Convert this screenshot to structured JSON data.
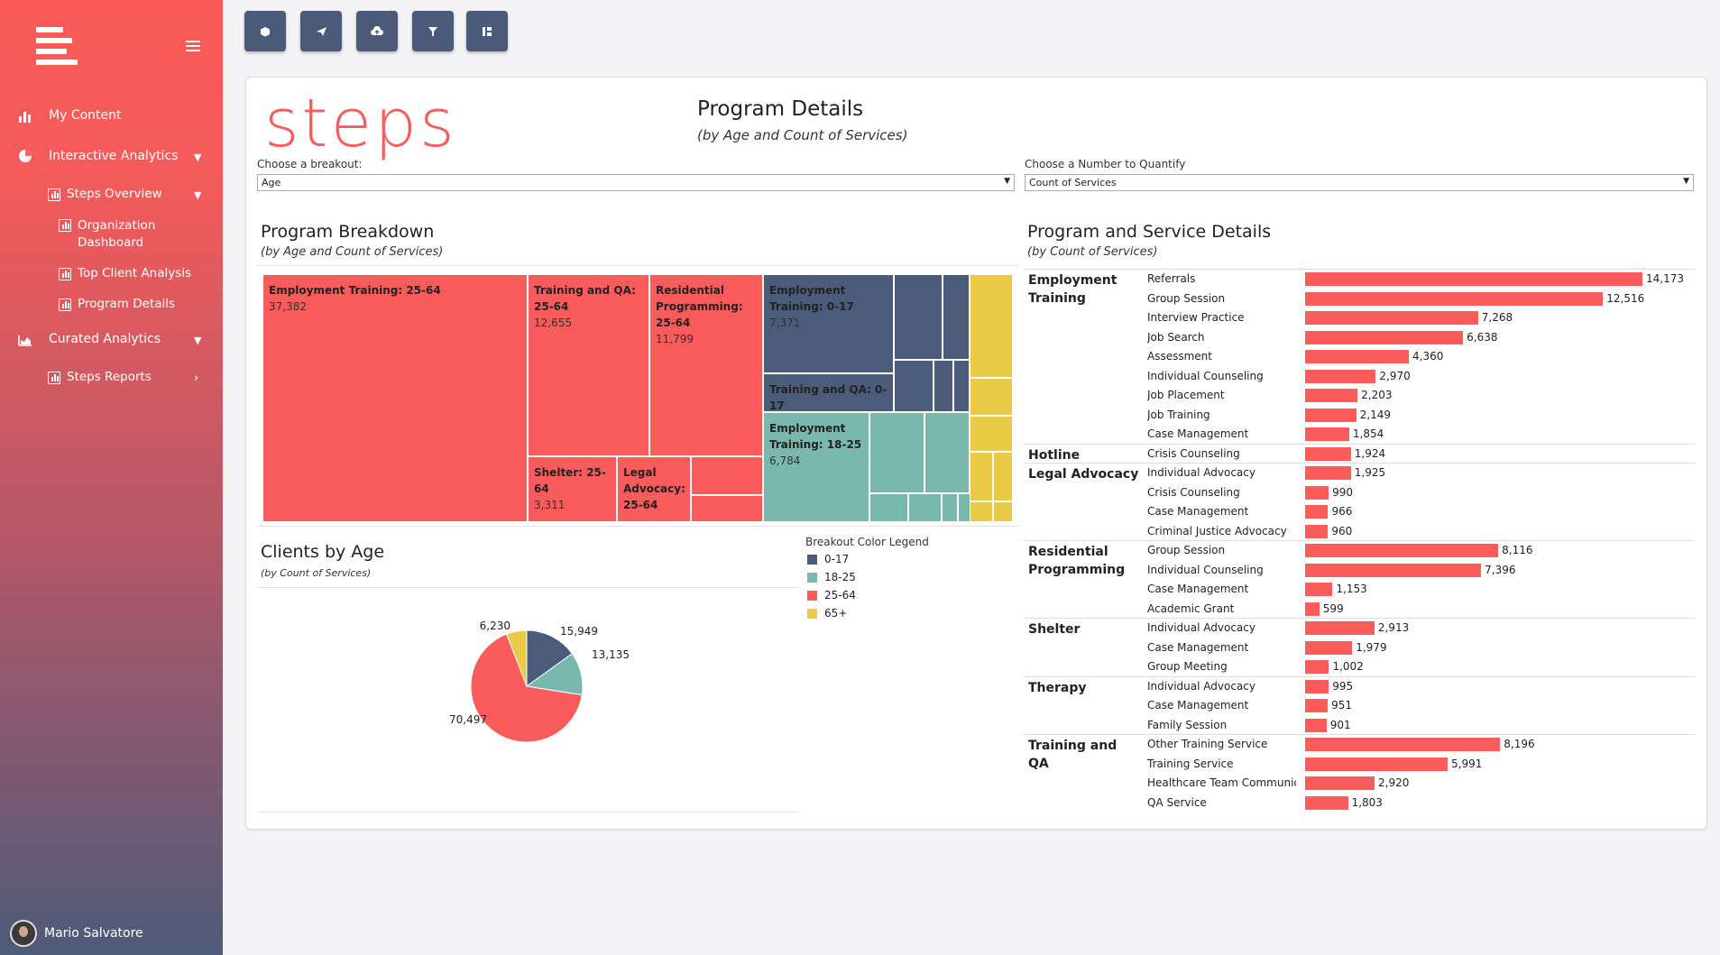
{
  "sidebar": {
    "nav": [
      {
        "label": "My Content",
        "icon": "bar-chart-icon"
      },
      {
        "label": "Interactive Analytics",
        "icon": "pie-chart-icon"
      },
      {
        "label": "Curated Analytics",
        "icon": "area-chart-icon"
      }
    ],
    "sub_items": [
      {
        "label": "Steps Overview"
      },
      {
        "label": "Organization Dashboard"
      },
      {
        "label": "Top Client Analysis"
      },
      {
        "label": "Program Details"
      },
      {
        "label": "Steps Reports"
      }
    ],
    "user": "Mario Salvatore"
  },
  "toolbar": [
    "cube-icon",
    "send-icon",
    "cloud-upload-icon",
    "filter-icon",
    "columns-icon"
  ],
  "header": {
    "brand": "steps",
    "title": "Program Details",
    "subtitle": "(by Age and Count of Services)"
  },
  "filters": {
    "breakout_label": "Choose a breakout:",
    "breakout_value": "Age",
    "quantify_label": "Choose a Number to Quantify",
    "quantify_value": "Count of Services"
  },
  "breakdown": {
    "title": "Program Breakdown",
    "subtitle": "(by Age and Count of Services)",
    "tiles": [
      {
        "label": "Employment Training: 25-64",
        "value": "37,382"
      },
      {
        "label": "Training and QA: 25-64",
        "value": "12,655"
      },
      {
        "label": "Residential Programming: 25-64",
        "value": "11,799"
      },
      {
        "label": "Shelter: 25-64",
        "value": "3,311"
      },
      {
        "label": "Legal Advocacy: 25-64",
        "value": ""
      },
      {
        "label": "Employment Training: 0-17",
        "value": "7,371"
      },
      {
        "label": "Training and QA: 0-17",
        "value": ""
      },
      {
        "label": "Employment Training: 18-25",
        "value": "6,784"
      }
    ]
  },
  "clients": {
    "title": "Clients by Age",
    "subtitle": "(by Count of Services)"
  },
  "legend": {
    "title": "Breakout Color Legend",
    "items": [
      {
        "label": "0-17",
        "color": "#4a5c7a"
      },
      {
        "label": "18-25",
        "color": "#79b8ad"
      },
      {
        "label": "25-64",
        "color": "#fa5b5b"
      },
      {
        "label": "65+",
        "color": "#eaca47"
      }
    ]
  },
  "details": {
    "title": "Program and Service Details",
    "subtitle": "(by Count of Services)"
  },
  "chart_data": [
    {
      "type": "pie",
      "labels": [
        "0-17",
        "18-25",
        "25-64",
        "65+"
      ],
      "values": [
        15949,
        13135,
        70497,
        6230
      ],
      "value_labels": [
        "15,949",
        "13,135",
        "70,497",
        "6,230"
      ],
      "colors": [
        "#4a5c7a",
        "#79b8ad",
        "#fa5b5b",
        "#eaca47"
      ]
    },
    {
      "type": "bar",
      "orientation": "horizontal",
      "groups": [
        {
          "program": "Employment Training",
          "services": [
            {
              "name": "Referrals",
              "value": 14173,
              "label": "14,173"
            },
            {
              "name": "Group Session",
              "value": 12516,
              "label": "12,516"
            },
            {
              "name": "Interview Practice",
              "value": 7268,
              "label": "7,268"
            },
            {
              "name": "Job Search",
              "value": 6638,
              "label": "6,638"
            },
            {
              "name": "Assessment",
              "value": 4360,
              "label": "4,360"
            },
            {
              "name": "Individual Counseling",
              "value": 2970,
              "label": "2,970"
            },
            {
              "name": "Job Placement",
              "value": 2203,
              "label": "2,203"
            },
            {
              "name": "Job Training",
              "value": 2149,
              "label": "2,149"
            },
            {
              "name": "Case Management",
              "value": 1854,
              "label": "1,854"
            }
          ]
        },
        {
          "program": "Hotline",
          "services": [
            {
              "name": "Crisis Counseling",
              "value": 1924,
              "label": "1,924"
            }
          ]
        },
        {
          "program": "Legal Advocacy",
          "services": [
            {
              "name": "Individual Advocacy",
              "value": 1925,
              "label": "1,925"
            },
            {
              "name": "Crisis Counseling",
              "value": 990,
              "label": "990"
            },
            {
              "name": "Case Management",
              "value": 966,
              "label": "966"
            },
            {
              "name": "Criminal Justice Advocacy",
              "value": 960,
              "label": "960"
            }
          ]
        },
        {
          "program": "Residential Programming",
          "services": [
            {
              "name": "Group Session",
              "value": 8116,
              "label": "8,116"
            },
            {
              "name": "Individual Counseling",
              "value": 7396,
              "label": "7,396"
            },
            {
              "name": "Case Management",
              "value": 1153,
              "label": "1,153"
            },
            {
              "name": "Academic Grant",
              "value": 599,
              "label": "599"
            }
          ]
        },
        {
          "program": "Shelter",
          "services": [
            {
              "name": "Individual Advocacy",
              "value": 2913,
              "label": "2,913"
            },
            {
              "name": "Case Management",
              "value": 1979,
              "label": "1,979"
            },
            {
              "name": "Group Meeting",
              "value": 1002,
              "label": "1,002"
            }
          ]
        },
        {
          "program": "Therapy",
          "services": [
            {
              "name": "Individual Advocacy",
              "value": 995,
              "label": "995"
            },
            {
              "name": "Case Management",
              "value": 951,
              "label": "951"
            },
            {
              "name": "Family Session",
              "value": 901,
              "label": "901"
            }
          ]
        },
        {
          "program": "Training and QA",
          "services": [
            {
              "name": "Other Training Service",
              "value": 8196,
              "label": "8,196"
            },
            {
              "name": "Training Service",
              "value": 5991,
              "label": "5,991"
            },
            {
              "name": "Healthcare Team Communic..",
              "value": 2920,
              "label": "2,920"
            },
            {
              "name": "QA Service",
              "value": 1803,
              "label": "1,803"
            }
          ]
        }
      ],
      "xlim": [
        0,
        14173
      ]
    }
  ]
}
